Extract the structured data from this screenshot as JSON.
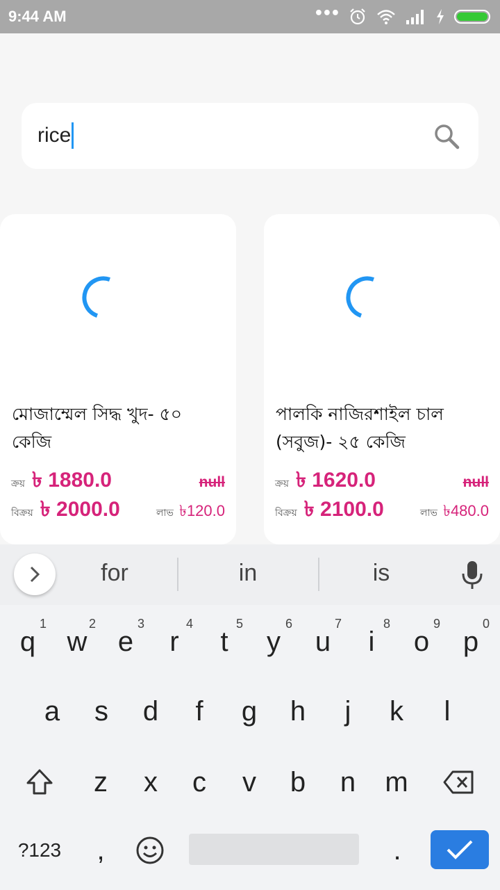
{
  "status_bar": {
    "time": "9:44 AM",
    "battery_color": "#35c935"
  },
  "search": {
    "value": "rice",
    "icon": "search-icon"
  },
  "products": [
    {
      "title": "মোজাম্মেল সিদ্ধ খুদ- ৫০ কেজি",
      "buy_label": "ক্রয়",
      "buy_price": "৳ 1880.0",
      "old_price": "null",
      "sell_label": "বিক্রয়",
      "sell_price": "৳ 2000.0",
      "profit_label": "লাভ",
      "profit_value": "৳120.0"
    },
    {
      "title": "পালকি নাজিরশাইল চাল (সবুজ)- ২৫ কেজি",
      "buy_label": "ক্রয়",
      "buy_price": "৳ 1620.0",
      "old_price": "null",
      "sell_label": "বিক্রয়",
      "sell_price": "৳ 2100.0",
      "profit_label": "লাভ",
      "profit_value": "৳480.0"
    }
  ],
  "keyboard": {
    "suggestions": [
      "for",
      "in",
      "is"
    ],
    "row1": [
      {
        "k": "q",
        "n": "1"
      },
      {
        "k": "w",
        "n": "2"
      },
      {
        "k": "e",
        "n": "3"
      },
      {
        "k": "r",
        "n": "4"
      },
      {
        "k": "t",
        "n": "5"
      },
      {
        "k": "y",
        "n": "6"
      },
      {
        "k": "u",
        "n": "7"
      },
      {
        "k": "i",
        "n": "8"
      },
      {
        "k": "o",
        "n": "9"
      },
      {
        "k": "p",
        "n": "0"
      }
    ],
    "row2": [
      "a",
      "s",
      "d",
      "f",
      "g",
      "h",
      "j",
      "k",
      "l"
    ],
    "row3": [
      "z",
      "x",
      "c",
      "v",
      "b",
      "n",
      "m"
    ],
    "symbols_label": "?123",
    "comma": ",",
    "period": ".",
    "accent_color": "#2a7de1"
  },
  "colors": {
    "price": "#d6237a",
    "spinner": "#2196f3"
  }
}
